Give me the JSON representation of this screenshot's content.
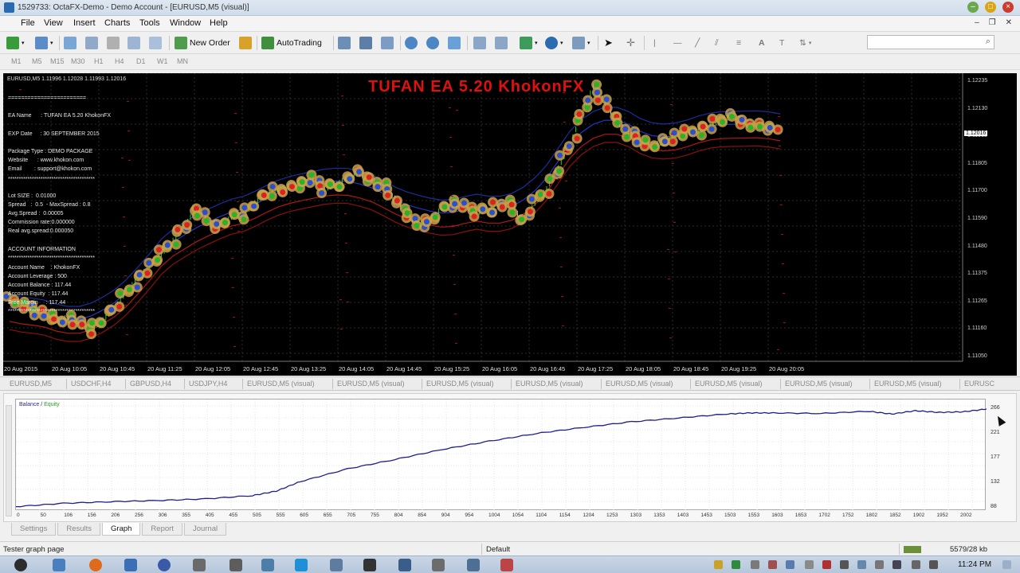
{
  "window": {
    "title": "1529733: OctaFX-Demo - Demo Account - [EURUSD,M5 (visual)]"
  },
  "menu": [
    "File",
    "View",
    "Insert",
    "Charts",
    "Tools",
    "Window",
    "Help"
  ],
  "toolbar": {
    "new_order": "New Order",
    "autotrading": "AutoTrading"
  },
  "timeframes": [
    "M1",
    "M5",
    "M15",
    "M30",
    "H1",
    "H4",
    "D1",
    "W1",
    "MN"
  ],
  "chart": {
    "header": "EURUSD,M5  1.11996 1.12028 1.11993 1.12016",
    "ea_title": "TUFAN EA  5.20  KhokonFX",
    "info_lines": [
      "========================",
      "EA Name      : TUFAN EA 5.20 KhokonFX",
      "EXP Date     : 30 SEPTEMBER 2015",
      "Package Type : DEMO PACKAGE",
      "Website      : www.khokon.com",
      "Email        : support@khokon.com",
      "****************************************",
      "Lot SIZE :  0.01000",
      "Spread   :  0.5  - MaxSpread : 0.8",
      "Avg.Spread :  0.00005",
      "Commission rate:0.000000",
      "Real avg.spread:0.000050",
      "ACCOUNT INFORMATION",
      "****************************************",
      "Account Name    : KhokonFX",
      "Account Leverage : 500",
      "Account Balance : 117.44",
      "Account Equity  : 117.44",
      "Free Margin     : 117.44",
      "****************************************"
    ],
    "current_price": "1.12016",
    "y_ticks": [
      "1.12235",
      "1.12130",
      "1.11915",
      "1.11805",
      "1.11700",
      "1.11590",
      "1.11480",
      "1.11375",
      "1.11265",
      "1.11160",
      "1.11050"
    ],
    "x_ticks": [
      "20 Aug 2015",
      "20 Aug 10:05",
      "20 Aug 10:45",
      "20 Aug 11:25",
      "20 Aug 12:05",
      "20 Aug 12:45",
      "20 Aug 13:25",
      "20 Aug 14:05",
      "20 Aug 14:45",
      "20 Aug 15:25",
      "20 Aug 16:05",
      "20 Aug 16:45",
      "20 Aug 17:25",
      "20 Aug 18:05",
      "20 Aug 18:45",
      "20 Aug 19:25",
      "20 Aug 20:05"
    ],
    "price_path": [
      1.1128,
      1.11265,
      1.1125,
      1.1122,
      1.112,
      1.1121,
      1.1118,
      1.1116,
      1.112,
      1.1125,
      1.1132,
      1.1138,
      1.1143,
      1.1148,
      1.1154,
      1.116,
      1.1168,
      1.1162,
      1.116,
      1.1164,
      1.1165,
      1.117,
      1.1174,
      1.1176,
      1.1177,
      1.1178,
      1.118,
      1.1176,
      1.1178,
      1.1181,
      1.1183,
      1.118,
      1.1177,
      1.1172,
      1.1165,
      1.1161,
      1.1162,
      1.1168,
      1.117,
      1.1168,
      1.1166,
      1.1167,
      1.117,
      1.1169,
      1.1162,
      1.117,
      1.1176,
      1.1185,
      1.1195,
      1.1208,
      1.122,
      1.1213,
      1.1205,
      1.12,
      1.1197,
      1.1195,
      1.1196,
      1.1199,
      1.12,
      1.1201,
      1.1203,
      1.1206,
      1.1207,
      1.1205,
      1.1203,
      1.1201,
      1.12016
    ]
  },
  "chart_tabs": [
    "EURUSD,M5",
    "USDCHF,H4",
    "GBPUSD,H4",
    "USDJPY,H4",
    "EURUSD,M5 (visual)",
    "EURUSD,M5 (visual)",
    "EURUSD,M5 (visual)",
    "EURUSD,M5 (visual)",
    "EURUSD,M5 (visual)",
    "EURUSD,M5 (visual)",
    "EURUSD,M5 (visual)",
    "EURUSD,M5 (visual)",
    "EURUSC"
  ],
  "graph": {
    "legend_balance": "Balance",
    "legend_sep": " / ",
    "legend_equity": "Equity",
    "y_ticks": [
      "266",
      "221",
      "177",
      "132",
      "88"
    ],
    "x_ticks": [
      "0",
      "50",
      "106",
      "156",
      "206",
      "256",
      "306",
      "355",
      "405",
      "455",
      "505",
      "555",
      "605",
      "655",
      "705",
      "755",
      "804",
      "854",
      "904",
      "954",
      "1004",
      "1054",
      "1104",
      "1154",
      "1204",
      "1253",
      "1303",
      "1353",
      "1403",
      "1453",
      "1503",
      "1553",
      "1603",
      "1653",
      "1702",
      "1752",
      "1802",
      "1852",
      "1902",
      "1952",
      "2002"
    ]
  },
  "chart_data": {
    "type": "line",
    "title": "",
    "xlabel": "",
    "ylabel": "",
    "ylim": [
      88,
      266
    ],
    "xlim": [
      0,
      2050
    ],
    "series": [
      {
        "name": "Balance",
        "x": [
          0,
          100,
          200,
          300,
          400,
          500,
          550,
          600,
          700,
          800,
          900,
          1000,
          1100,
          1200,
          1300,
          1400,
          1500,
          1550,
          1600,
          1700,
          1800,
          1850,
          1900,
          1950,
          2000,
          2050
        ],
        "values": [
          90,
          96,
          99,
          101,
          104,
          110,
          118,
          135,
          158,
          175,
          193,
          208,
          222,
          233,
          243,
          250,
          257,
          259,
          259,
          258,
          262,
          257,
          263,
          260,
          261,
          266
        ]
      }
    ]
  },
  "bottom_tabs": [
    "Settings",
    "Results",
    "Graph",
    "Report",
    "Journal"
  ],
  "status": {
    "left": "Tester graph page",
    "profile": "Default",
    "traffic": "5579/28 kb"
  },
  "clock": "11:24 PM"
}
